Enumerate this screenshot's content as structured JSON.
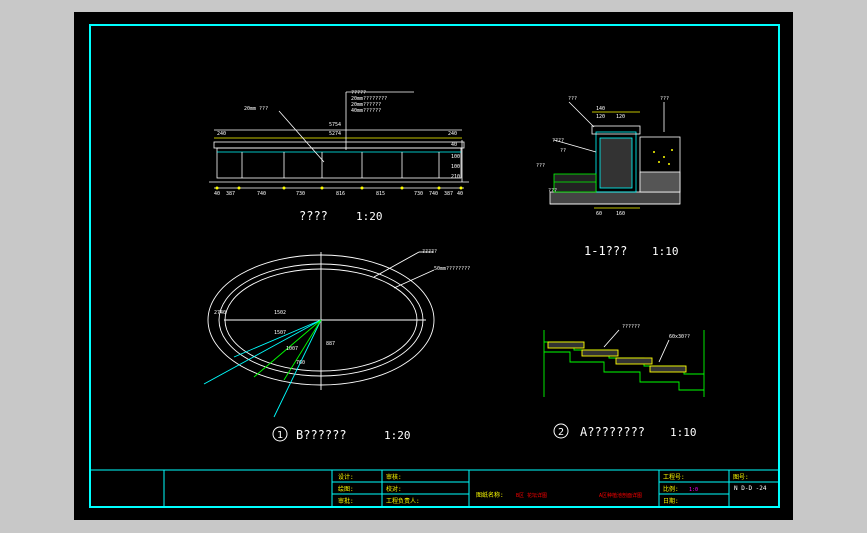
{
  "colors": {
    "background": "#c8c8c8",
    "sheet": "#000000",
    "frame": "#00ffff",
    "line": "#ffffff",
    "accent": "#ffff00",
    "label": "#00ff00",
    "red_text": "#ff0000"
  },
  "elevation": {
    "title": "????",
    "scale": "1:20",
    "callouts": [
      "?????",
      "20mm????????",
      "20mm??????",
      "40mm??????"
    ],
    "side_callout": "20mm ???",
    "top_dims": [
      "5754",
      "5274",
      "240",
      "240"
    ],
    "right_dims": [
      "40",
      "100",
      "100",
      "210"
    ],
    "bottom_dims": [
      "40",
      "387",
      "740",
      "730",
      "816",
      "815",
      "730",
      "740",
      "387",
      "40"
    ]
  },
  "section": {
    "title": "1-1???",
    "scale": "1:10",
    "labels_left": [
      "???",
      "????",
      "??",
      "???",
      "???"
    ],
    "labels_right": [
      "???"
    ],
    "top_dims": [
      "140",
      "120",
      "120"
    ],
    "bottom_dims": [
      "60",
      "160"
    ]
  },
  "plan": {
    "circle_num": "1",
    "title": "B??????",
    "scale": "1:20",
    "labels": [
      "?????",
      "50mm????????"
    ],
    "dims": [
      "1502",
      "887",
      "1507",
      "1007",
      "2740",
      "760"
    ]
  },
  "detail": {
    "circle_num": "2",
    "title": "A????????",
    "scale": "1:10",
    "labels": [
      "??????",
      "60x30??"
    ]
  },
  "titleblock": {
    "design": "设计:",
    "review": "审核:",
    "drafting": "绘图:",
    "check": "校对:",
    "approve": "审批:",
    "project_lead": "工程负责人:",
    "drawing_name_label": "图纸名称:",
    "drawing_name_1": "B区 花坛详图",
    "drawing_name_2": "A区种植池剖面详图",
    "project_no": "工程号:",
    "drawing_no_label": "图号:",
    "drawing_no": "N D-D -24",
    "scale_label": "比例:",
    "scale_value": "1:0",
    "date_label": "日期:"
  }
}
